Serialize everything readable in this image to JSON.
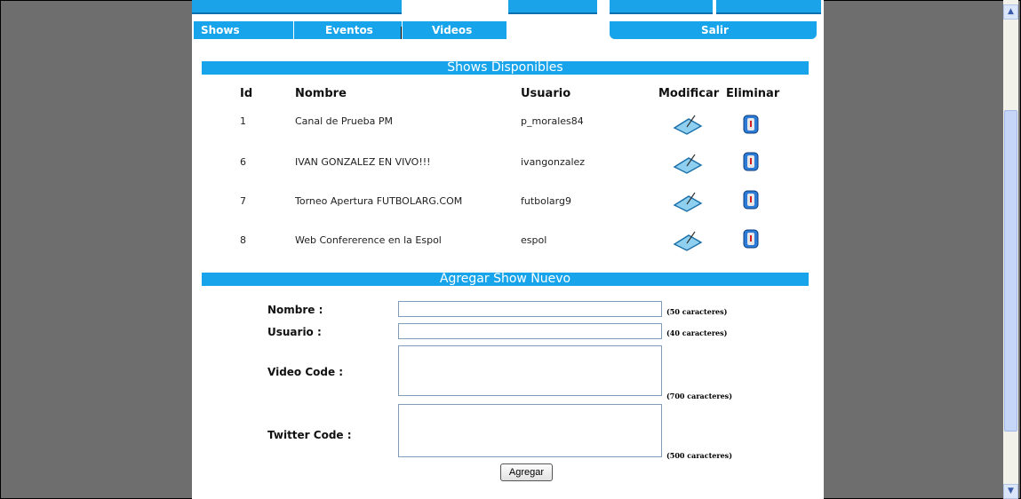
{
  "nav": {
    "tabs": [
      "Shows",
      "Eventos",
      "Videos",
      "Salir"
    ]
  },
  "shows": {
    "title": "Shows Disponibles",
    "headers": [
      "Id",
      "Nombre",
      "Usuario",
      "Modificar",
      "Eliminar"
    ],
    "rows": [
      {
        "id": "1",
        "nombre": "Canal de Prueba PM",
        "usuario": "p_morales84"
      },
      {
        "id": "6",
        "nombre": "IVAN GONZALEZ EN VIVO!!!",
        "usuario": "ivangonzalez"
      },
      {
        "id": "7",
        "nombre": "Torneo Apertura FUTBOLARG.COM",
        "usuario": "futbolarg9"
      },
      {
        "id": "8",
        "nombre": "Web Confererence en la Espol",
        "usuario": "espol"
      }
    ],
    "icons": {
      "modify": "edit-pencil-icon",
      "delete": "trash-bin-icon"
    }
  },
  "form": {
    "title": "Agregar Show Nuevo",
    "nombre_label": "Nombre :",
    "nombre_value": "",
    "nombre_hint": "(50 caracteres)",
    "usuario_label": "Usuario :",
    "usuario_value": "",
    "usuario_hint": "(40 caracteres)",
    "video_label": "Video Code :",
    "video_value": "",
    "video_hint": "(700 caracteres)",
    "twitter_label": "Twitter Code :",
    "twitter_value": "",
    "twitter_hint": "(500 caracteres)",
    "submit_label": "Agregar"
  },
  "colors": {
    "accent": "#18a4ea",
    "background": "#6e6e6e"
  }
}
